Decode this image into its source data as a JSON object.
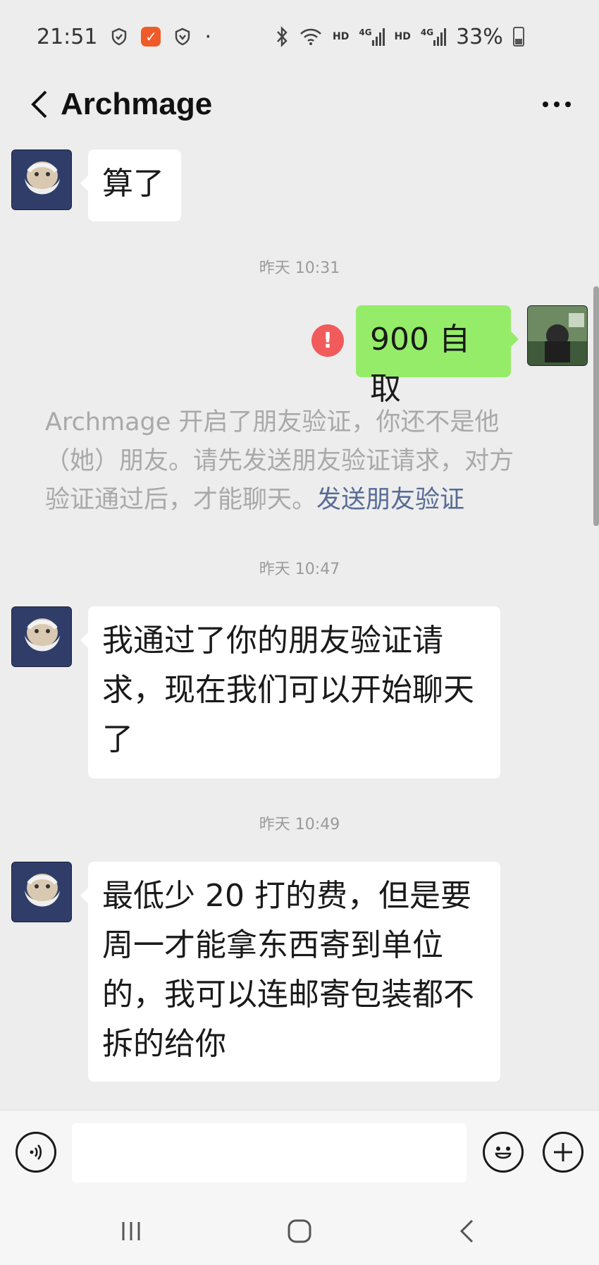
{
  "status_bar": {
    "time": "21:51",
    "notif_badge": "✓",
    "dot": "·",
    "hd1": "HD",
    "net1": "4G",
    "hd2": "HD",
    "net2": "4G",
    "battery_text": "33%",
    "battery_level": 0.33
  },
  "header": {
    "title": "Archmage",
    "more_label": "···"
  },
  "messages": [
    {
      "sender": "Archmage",
      "text": "算了"
    },
    {
      "time": "昨天 10:31"
    },
    {
      "sender": "me",
      "text": "900 自取",
      "status": "!"
    },
    {
      "system": "Archmage 开启了朋友验证，你还不是他（她）朋友。请先发送朋友验证请求，对方验证通过后，才能聊天。",
      "link": "发送朋友验证"
    },
    {
      "time": "昨天 10:47"
    },
    {
      "sender": "Archmage",
      "text": "我通过了你的朋友验证请求，现在我们可以开始聊天了"
    },
    {
      "time": "昨天 10:49"
    },
    {
      "sender": "Archmage",
      "text": "最低少 20 打的费，但是要周一才能拿东西寄到单位的，我可以连邮寄包装都不拆的给你"
    }
  ],
  "chat": {
    "msg1": "算了",
    "time1": "昨天 10:31",
    "msg2": "900 自取",
    "msg2_status": "!",
    "sys_line1": "Archmage 开启了朋友验证，你还不是他",
    "sys_line2": "（她）朋友。请先发送朋友验证请求，对方",
    "sys_line3": "验证通过后，才能聊天。",
    "sys_link": "发送朋友验证",
    "time2": "昨天 10:47",
    "msg3_line1": "我通过了你的朋友验证请",
    "msg3_line2": "求，现在我们可以开始聊天",
    "msg3_line3": "了",
    "time3": "昨天 10:49",
    "msg4_line1": "最低少 20 打的费，但是要",
    "msg4_line2": "周一才能拿东西寄到单位",
    "msg4_line3": "的，我可以连邮寄包装都不",
    "msg4_line4": "拆的给你"
  },
  "input": {
    "placeholder": ""
  },
  "icons": {
    "back": "back-arrow-icon",
    "more": "more-dots-icon",
    "voice": "voice-icon",
    "emoji": "emoji-icon",
    "plus": "plus-icon",
    "error": "error-icon"
  },
  "colors": {
    "background": "#ededed",
    "my_bubble": "#95ec69",
    "their_bubble": "#ffffff",
    "error": "#f15b5b",
    "link": "#576b95",
    "notif_badge": "#f05a28"
  }
}
